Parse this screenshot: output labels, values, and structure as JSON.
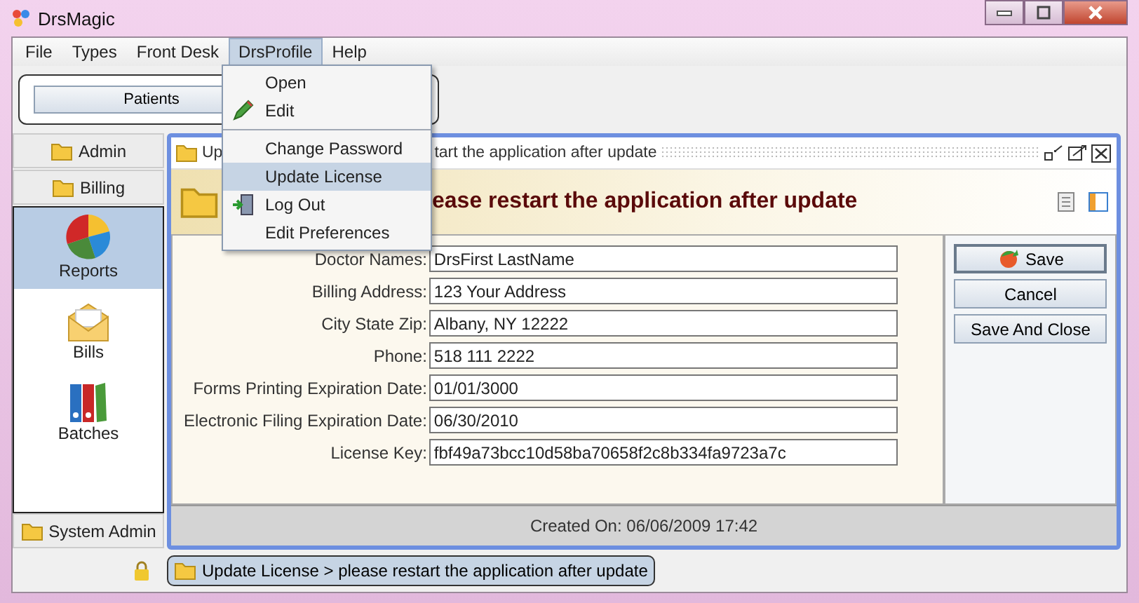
{
  "window": {
    "title": "DrsMagic"
  },
  "menu_bar": [
    {
      "label": "File",
      "selected": false
    },
    {
      "label": "Types",
      "selected": false
    },
    {
      "label": "Front Desk",
      "selected": false
    },
    {
      "label": "DrsProfile",
      "selected": true
    },
    {
      "label": "Help",
      "selected": false
    }
  ],
  "open_menu": {
    "groups": [
      [
        {
          "label": "Open",
          "selected": false
        },
        {
          "label": "Edit",
          "selected": false
        }
      ],
      [
        {
          "label": "Change Password",
          "selected": false
        },
        {
          "label": "Update License",
          "selected": true
        },
        {
          "label": "Log Out",
          "selected": false
        },
        {
          "label": "Edit Preferences",
          "selected": false
        }
      ]
    ]
  },
  "toolbar": {
    "buttons": [
      "Patients"
    ]
  },
  "sidebar": {
    "top_sections": [
      "Admin",
      "Billing"
    ],
    "items": [
      {
        "label": "Reports",
        "selected": true
      },
      {
        "label": "Bills",
        "selected": false
      },
      {
        "label": "Batches",
        "selected": false
      }
    ],
    "bottom_sections": [
      "System Admin"
    ]
  },
  "internal_frame": {
    "title_parts": [
      "Up",
      "tart the application after update"
    ],
    "header": "ease restart the application after update",
    "fields": [
      {
        "label": "Doctor Names:",
        "value": "DrsFirst LastName"
      },
      {
        "label": "Billing Address:",
        "value": "123 Your Address"
      },
      {
        "label": "City State Zip:",
        "value": "Albany, NY 12222"
      },
      {
        "label": "Phone:",
        "value": "518 111 2222"
      },
      {
        "label": "Forms Printing Expiration Date:",
        "value": "01/01/3000"
      },
      {
        "label": "Electronic Filing Expiration Date:",
        "value": "06/30/2010"
      },
      {
        "label": "License Key:",
        "value": "fbf49a73bcc10d58ba70658f2c8b334fa9723a7c"
      }
    ],
    "buttons": [
      {
        "label": "Save",
        "default": true
      },
      {
        "label": "Cancel",
        "default": false
      },
      {
        "label": "Save And Close",
        "default": false
      }
    ],
    "footer": "Created On: 06/06/2009 17:42"
  },
  "status_bar": {
    "breadcrumb": "Update License > please restart the application after update"
  }
}
